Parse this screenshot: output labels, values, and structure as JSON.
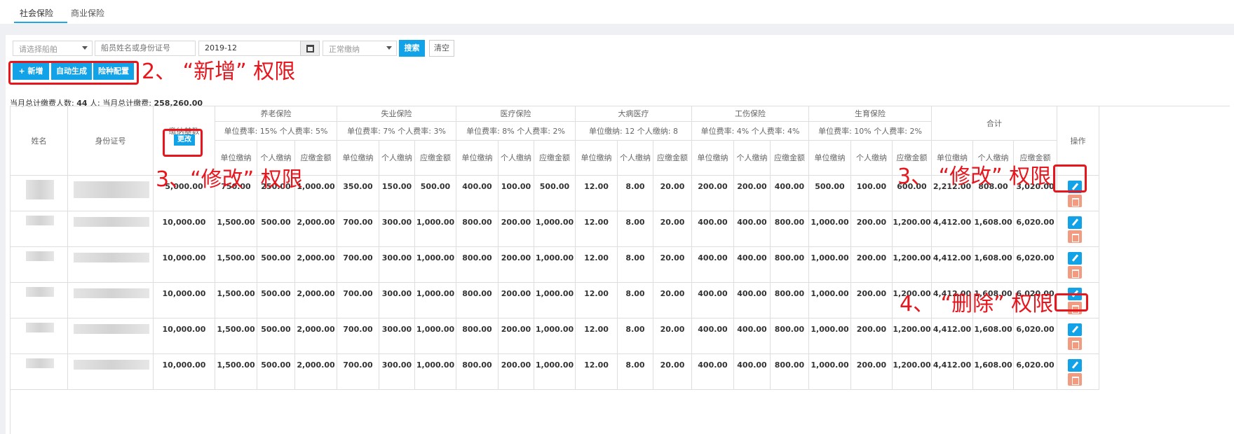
{
  "tabs": [
    {
      "label": "社会保险",
      "active": true
    },
    {
      "label": "商业保险",
      "active": false
    }
  ],
  "filters": {
    "ship_select": "请选择船舶",
    "search_placeholder": "船员姓名或身份证号",
    "month_value": "2019-12",
    "status_select": "正常缴纳",
    "search_button": "搜索",
    "clear_button": "清空"
  },
  "toolbar": {
    "add_button": "新增",
    "auto_generate_button": "自动生成",
    "insurance_config_button": "险种配置"
  },
  "summary": {
    "people_prefix": "当月总计缴费人数:",
    "people_count": "44",
    "people_suffix": "人;",
    "amount_prefix": "当月总计缴费:",
    "amount": "258,260.00"
  },
  "table": {
    "col_name": "姓名",
    "col_id": "身份证号",
    "col_base": "缴纳基数",
    "change_button": "更改",
    "col_ops": "操作",
    "groups": [
      {
        "name": "养老保险",
        "rate": "单位费率: 15% 个人费率: 5%"
      },
      {
        "name": "失业保险",
        "rate": "单位费率: 7% 个人费率: 3%"
      },
      {
        "name": "医疗保险",
        "rate": "单位费率: 8% 个人费率: 2%"
      },
      {
        "name": "大病医疗",
        "rate": "单位缴纳: 12 个人缴纳: 8"
      },
      {
        "name": "工伤保险",
        "rate": "单位费率: 4% 个人费率: 4%"
      },
      {
        "name": "生育保险",
        "rate": "单位费率: 10% 个人费率: 2%"
      },
      {
        "name": "合计",
        "rate": ""
      }
    ],
    "sub_headers": [
      "单位缴纳",
      "个人缴纳",
      "应缴金额"
    ],
    "total_sub_headers": [
      "单位缴纳",
      "个人缴纳",
      "应缴金额"
    ],
    "rows": [
      [
        "5,000.00",
        "750.00",
        "250.00",
        "1,000.00",
        "350.00",
        "150.00",
        "500.00",
        "400.00",
        "100.00",
        "500.00",
        "12.00",
        "8.00",
        "20.00",
        "200.00",
        "200.00",
        "400.00",
        "500.00",
        "100.00",
        "600.00",
        "2,212.00",
        "808.00",
        "3,020.00"
      ],
      [
        "10,000.00",
        "1,500.00",
        "500.00",
        "2,000.00",
        "700.00",
        "300.00",
        "1,000.00",
        "800.00",
        "200.00",
        "1,000.00",
        "12.00",
        "8.00",
        "20.00",
        "400.00",
        "400.00",
        "800.00",
        "1,000.00",
        "200.00",
        "1,200.00",
        "4,412.00",
        "1,608.00",
        "6,020.00"
      ],
      [
        "10,000.00",
        "1,500.00",
        "500.00",
        "2,000.00",
        "700.00",
        "300.00",
        "1,000.00",
        "800.00",
        "200.00",
        "1,000.00",
        "12.00",
        "8.00",
        "20.00",
        "400.00",
        "400.00",
        "800.00",
        "1,000.00",
        "200.00",
        "1,200.00",
        "4,412.00",
        "1,608.00",
        "6,020.00"
      ],
      [
        "10,000.00",
        "1,500.00",
        "500.00",
        "2,000.00",
        "700.00",
        "300.00",
        "1,000.00",
        "800.00",
        "200.00",
        "1,000.00",
        "12.00",
        "8.00",
        "20.00",
        "400.00",
        "400.00",
        "800.00",
        "1,000.00",
        "200.00",
        "1,200.00",
        "4,412.00",
        "1,608.00",
        "6,020.00"
      ],
      [
        "10,000.00",
        "1,500.00",
        "500.00",
        "2,000.00",
        "700.00",
        "300.00",
        "1,000.00",
        "800.00",
        "200.00",
        "1,000.00",
        "12.00",
        "8.00",
        "20.00",
        "400.00",
        "400.00",
        "800.00",
        "1,000.00",
        "200.00",
        "1,200.00",
        "4,412.00",
        "1,608.00",
        "6,020.00"
      ],
      [
        "10,000.00",
        "1,500.00",
        "500.00",
        "2,000.00",
        "700.00",
        "300.00",
        "1,000.00",
        "800.00",
        "200.00",
        "1,000.00",
        "12.00",
        "8.00",
        "20.00",
        "400.00",
        "400.00",
        "800.00",
        "1,000.00",
        "200.00",
        "1,200.00",
        "4,412.00",
        "1,608.00",
        "6,020.00"
      ]
    ]
  },
  "annotations": {
    "add_permission": "2、 “新增” 权限",
    "edit_permission_base": "3、“修改” 权限",
    "edit_permission_row": "3、 “修改” 权限",
    "delete_permission": "4、 “删除” 权限"
  },
  "colors": {
    "accent": "#11a2e8",
    "delete": "#f39b80",
    "annotation": "#e8151d"
  }
}
